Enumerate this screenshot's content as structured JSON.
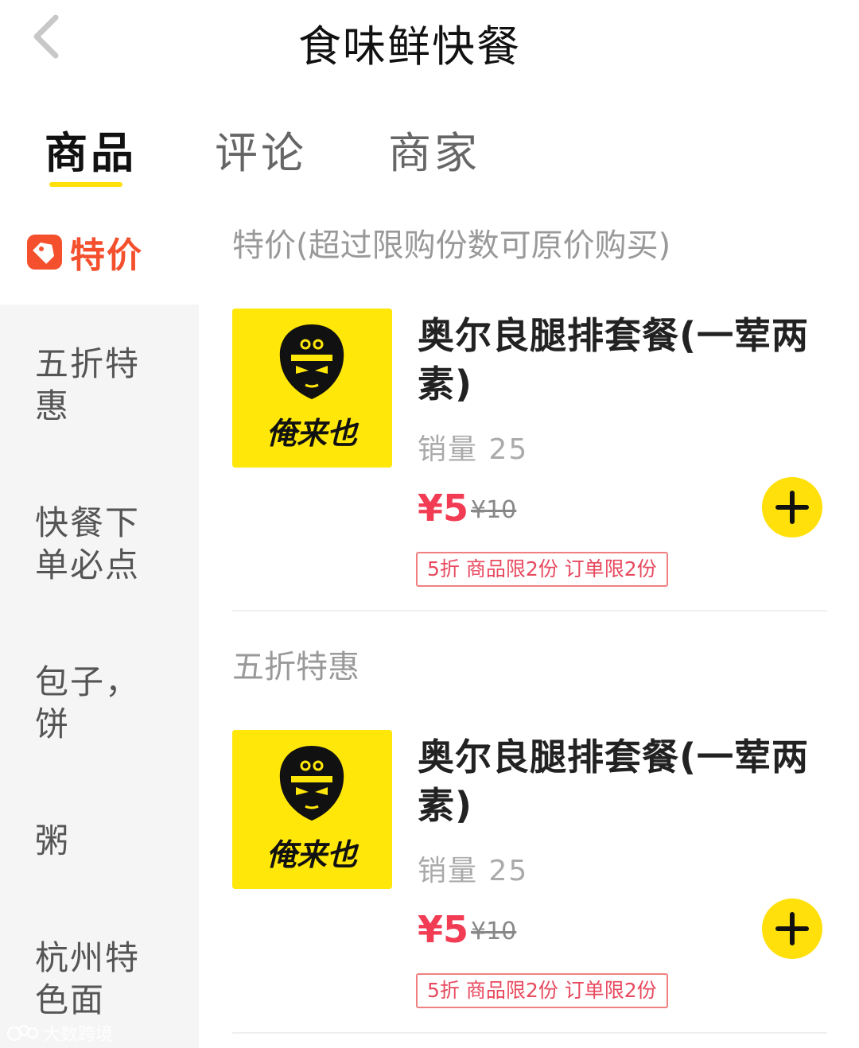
{
  "header": {
    "title": "食味鲜快餐"
  },
  "tabs": [
    {
      "label": "商品"
    },
    {
      "label": "评论"
    },
    {
      "label": "商家"
    }
  ],
  "sidebar": {
    "active_label": "特价",
    "items": [
      {
        "label": "五折特惠"
      },
      {
        "label": "快餐下单必点"
      },
      {
        "label": "包子，饼"
      },
      {
        "label": "粥"
      },
      {
        "label": "杭州特色面"
      }
    ]
  },
  "sections": [
    {
      "title": "特价(超过限购份数可原价购买)",
      "product": {
        "name": "奥尔良腿排套餐(一荤两素)",
        "sales": "销量 25",
        "price": "¥5",
        "original_price": "¥10",
        "tag": "5折 商品限2份 订单限2份",
        "logo_text": "俺来也"
      }
    },
    {
      "title": "五折特惠",
      "product": {
        "name": "奥尔良腿排套餐(一荤两素)",
        "sales": "销量 25",
        "price": "¥5",
        "original_price": "¥10",
        "tag": "5折 商品限2份 订单限2份",
        "logo_text": "俺来也"
      }
    }
  ],
  "watermark": "大数跨境",
  "colors": {
    "accent_yellow": "#ffe00a",
    "price_red": "#f23c54",
    "active_orange": "#f4502e"
  },
  "icons": {
    "back": "chevron-left-icon",
    "special": "price-tag-icon",
    "add": "plus-icon"
  }
}
